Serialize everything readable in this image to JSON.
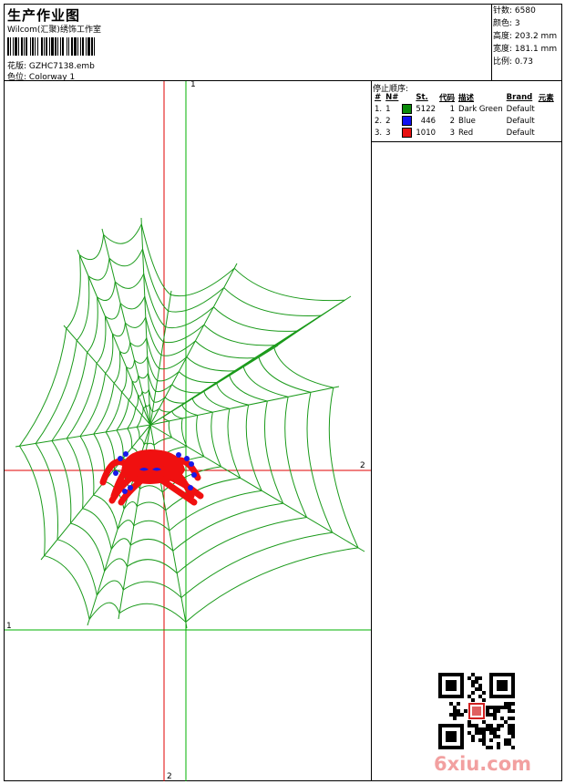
{
  "header": {
    "title": "生产作业图",
    "company": "Wilcom(汇聚)绣饰工作室",
    "design_label": "花版:",
    "design_value": "GZHC7138.emb",
    "colorway_label": "色位:",
    "colorway_value": "Colorway 1"
  },
  "stats": {
    "stitches_label": "针数:",
    "stitches": "6580",
    "colors_label": "颜色:",
    "colors": "3",
    "height_label": "高度:",
    "height": "203.2 mm",
    "width_label": "宽度:",
    "width": "181.1 mm",
    "ratio_label": "比例:",
    "ratio": "0.73"
  },
  "stop_sequence": {
    "title": "停止顺序:",
    "headers": [
      "#",
      "N#",
      "St.",
      "代码",
      "描述",
      "Brand",
      "元素"
    ],
    "rows": [
      {
        "idx": "1.",
        "n": "1",
        "color": "#0a8a0a",
        "st": "5122",
        "code": "1",
        "desc": "Dark Green",
        "brand": "Default"
      },
      {
        "idx": "2.",
        "n": "2",
        "color": "#1010f0",
        "st": "446",
        "code": "2",
        "desc": "Blue",
        "brand": "Default"
      },
      {
        "idx": "3.",
        "n": "3",
        "color": "#e81010",
        "st": "1010",
        "code": "3",
        "desc": "Red",
        "brand": "Default"
      }
    ]
  },
  "axes": {
    "green_label_top": "1",
    "green_label_left": "1",
    "red_label_right": "2",
    "red_label_bottom": "2"
  },
  "watermark": "6xiu.com",
  "colors": {
    "web": "#1a9a1a",
    "spider_red": "#f01010",
    "spider_blue": "#1818e8",
    "axis_red": "#e00000",
    "axis_green": "#00b000"
  }
}
